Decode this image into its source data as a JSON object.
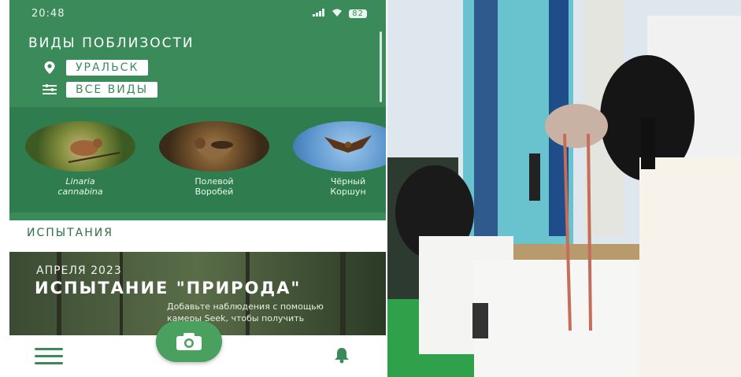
{
  "status": {
    "time": "20:48",
    "battery": "82"
  },
  "header": {
    "title": "ВИДЫ ПОБЛИЗОСТИ",
    "location": "УРАЛЬСК",
    "filter": "ВСЕ ВИДЫ"
  },
  "species": [
    {
      "name_line1": "Linaria",
      "name_line2": "cannabina",
      "italic": true
    },
    {
      "name_line1": "Полевой",
      "name_line2": "Воробей",
      "italic": false
    },
    {
      "name_line1": "Чёрный",
      "name_line2": "Коршун",
      "italic": false
    }
  ],
  "trials": {
    "heading": "ИСПЫТАНИЯ",
    "date": "АПРЕЛЯ 2023",
    "title": "ИСПЫТАНИЕ \"ПРИРОДА\"",
    "description": "Добавьте наблюдения с помощью камеры Seek, чтобы получить значок"
  },
  "bottom_nav": {
    "menu_icon": "hamburger-icon",
    "camera_icon": "camera-icon",
    "bell_icon": "bell-icon"
  },
  "colors": {
    "primary": "#3b8b5a",
    "strip": "#2f7d4f",
    "camera": "#4aa15f"
  }
}
